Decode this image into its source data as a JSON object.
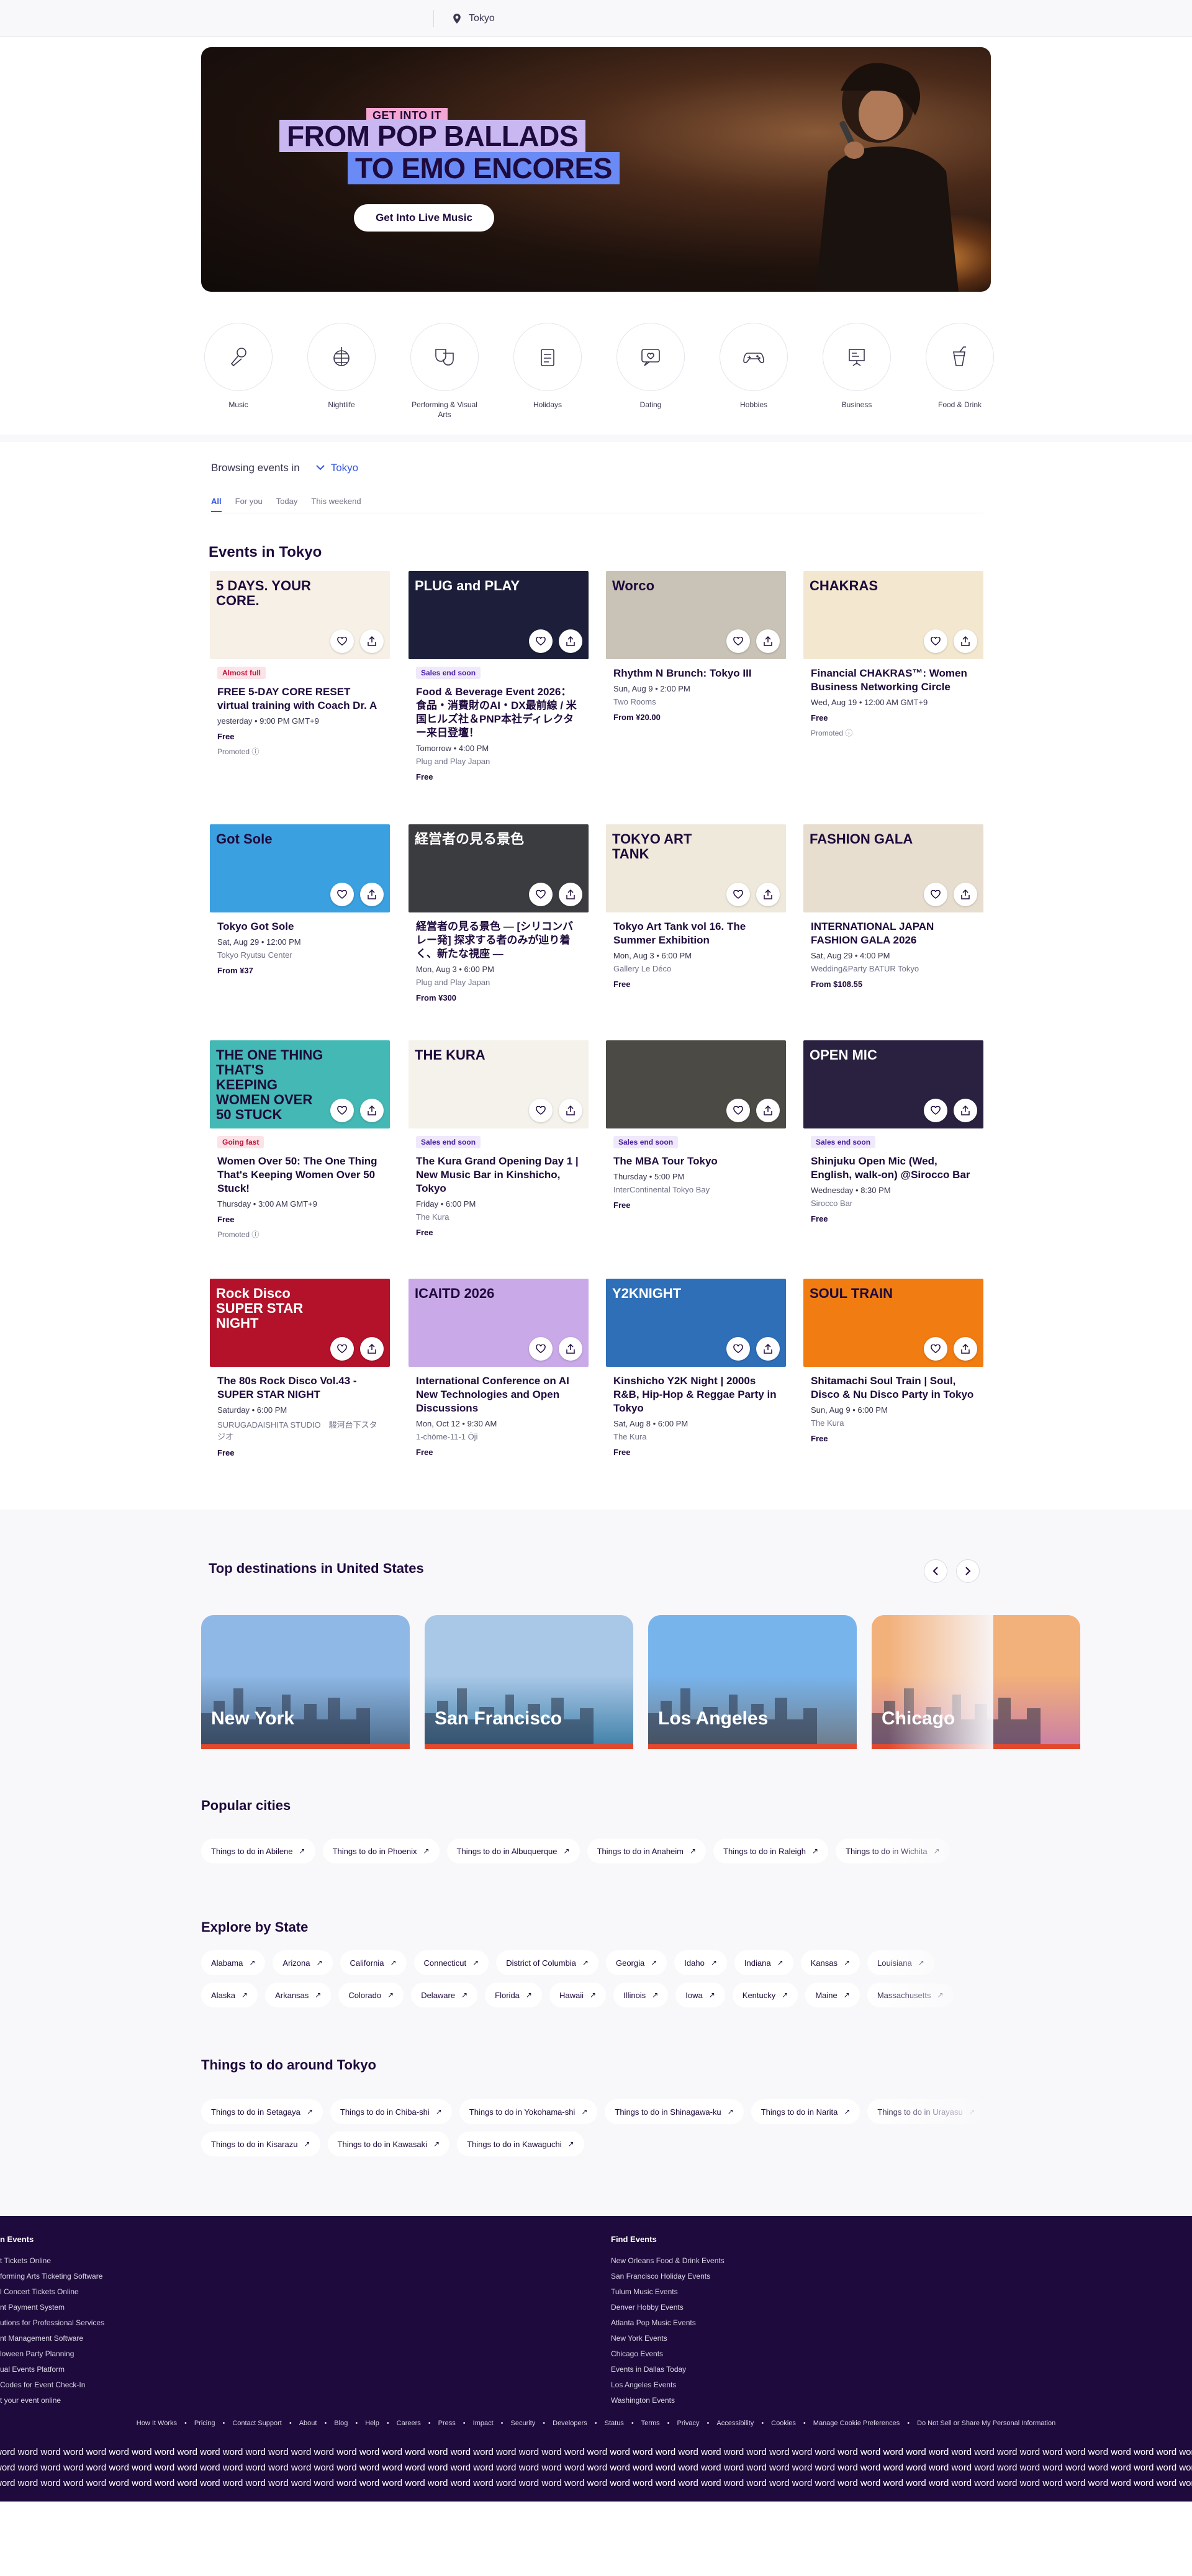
{
  "search": {
    "location": "Tokyo"
  },
  "hero": {
    "kicker": "GET INTO IT",
    "line1": "FROM POP BALLADS",
    "line2": "TO EMO ENCORES",
    "button": "Get Into Live Music"
  },
  "categories": [
    {
      "label": "Music",
      "icon": "microphone-icon"
    },
    {
      "label": "Nightlife",
      "icon": "disco-ball-icon"
    },
    {
      "label": "Performing & Visual Arts",
      "icon": "theater-masks-icon"
    },
    {
      "label": "Holidays",
      "icon": "calendar-icon"
    },
    {
      "label": "Dating",
      "icon": "chat-heart-icon"
    },
    {
      "label": "Hobbies",
      "icon": "gamepad-icon"
    },
    {
      "label": "Business",
      "icon": "presentation-icon"
    },
    {
      "label": "Food & Drink",
      "icon": "drink-icon"
    }
  ],
  "browse": {
    "label": "Browsing events in",
    "location": "Tokyo"
  },
  "tabs": [
    "All",
    "For you",
    "Today",
    "This weekend"
  ],
  "events_title": "Events in Tokyo",
  "events": [
    {
      "badge": "Almost full",
      "badge_type": "red",
      "title": "FREE 5-DAY CORE RESET virtual training with Coach Dr. A",
      "date": "yesterday • 9:00 PM GMT+9",
      "venue": "",
      "price": "Free",
      "promoted": "Promoted",
      "img_text": "5 DAYS. YOUR CORE.",
      "img_color": "#f7f0e6"
    },
    {
      "badge": "Sales end soon",
      "badge_type": "purple",
      "title": "Food & Beverage Event 2026：食品・消費財のAI・DX最前線 / 米国ヒルズ社＆PNP本社ディレクター来日登壇！",
      "date": "Tomorrow • 4:00 PM",
      "venue": "Plug and Play Japan",
      "price": "Free",
      "promoted": "",
      "img_text": "PLUG and PLAY",
      "img_color": "#1d1f3a"
    },
    {
      "badge": "",
      "badge_type": "",
      "title": "Rhythm N Brunch: Tokyo III",
      "date": "Sun, Aug 9 • 2:00 PM",
      "venue": "Two Rooms",
      "price": "From ¥20.00",
      "promoted": "",
      "img_text": "Worco",
      "img_color": "#c9c2b6"
    },
    {
      "badge": "",
      "badge_type": "",
      "title": "Financial CHAKRAS™: Women Business Networking Circle",
      "date": "Wed, Aug 19 • 12:00 AM GMT+9",
      "venue": "",
      "price": "Free",
      "promoted": "Promoted",
      "img_text": "CHAKRAS",
      "img_color": "#f3e8cf"
    },
    {
      "badge": "",
      "badge_type": "",
      "title": "Tokyo Got Sole",
      "date": "Sat, Aug 29 • 12:00 PM",
      "venue": "Tokyo Ryutsu Center",
      "price": "From ¥37",
      "promoted": "",
      "img_text": "Got Sole",
      "img_color": "#3aa0e0"
    },
    {
      "badge": "",
      "badge_type": "",
      "title": "経営者の見る景色 ― [シリコンバレー発] 探求する者のみが辿り着く、新たな視座 ―",
      "date": "Mon, Aug 3 • 6:00 PM",
      "venue": "Plug and Play Japan",
      "price": "From ¥300",
      "promoted": "",
      "img_text": "経営者の見る景色",
      "img_color": "#3a3c40"
    },
    {
      "badge": "",
      "badge_type": "",
      "title": "Tokyo Art Tank vol 16. The Summer Exhibition",
      "date": "Mon, Aug 3 • 6:00 PM",
      "venue": "Gallery Le Déco",
      "price": "Free",
      "promoted": "",
      "img_text": "TOKYO ART TANK",
      "img_color": "#efe9dc"
    },
    {
      "badge": "",
      "badge_type": "",
      "title": "INTERNATIONAL JAPAN FASHION GALA 2026",
      "date": "Sat, Aug 29 • 4:00 PM",
      "venue": "Wedding&Party BATUR Tokyo",
      "price": "From $108.55",
      "promoted": "",
      "img_text": "FASHION GALA",
      "img_color": "#e7ded0"
    },
    {
      "badge": "Going fast",
      "badge_type": "red",
      "title": "Women Over 50: The One Thing That's Keeping Women Over 50 Stuck!",
      "date": "Thursday • 3:00 AM GMT+9",
      "venue": "",
      "price": "Free",
      "promoted": "Promoted",
      "img_text": "THE ONE THING THAT'S KEEPING WOMEN OVER 50 STUCK",
      "img_color": "#43b8b4"
    },
    {
      "badge": "Sales end soon",
      "badge_type": "purple",
      "title": "The Kura Grand Opening Day 1 | New Music Bar in Kinshicho, Tokyo",
      "date": "Friday • 6:00 PM",
      "venue": "The Kura",
      "price": "Free",
      "promoted": "",
      "img_text": "THE KURA",
      "img_color": "#f4f2ea"
    },
    {
      "badge": "Sales end soon",
      "badge_type": "purple",
      "title": "The MBA Tour Tokyo",
      "date": "Thursday • 5:00 PM",
      "venue": "InterContinental Tokyo Bay",
      "price": "Free",
      "promoted": "",
      "img_text": "",
      "img_color": "#4b4a45"
    },
    {
      "badge": "Sales end soon",
      "badge_type": "purple",
      "title": "Shinjuku Open Mic (Wed, English, walk-on) @Sirocco Bar",
      "date": "Wednesday • 8:30 PM",
      "venue": "Sirocco Bar",
      "price": "Free",
      "promoted": "",
      "img_text": "OPEN MIC",
      "img_color": "#2a2140"
    },
    {
      "badge": "",
      "badge_type": "",
      "title": "The 80s Rock Disco Vol.43 - SUPER STAR NIGHT",
      "date": "Saturday • 6:00 PM",
      "venue": "SURUGADAISHITA STUDIO　駿河台下スタジオ",
      "price": "Free",
      "promoted": "",
      "img_text": "Rock Disco SUPER STAR NIGHT",
      "img_color": "#b3122a"
    },
    {
      "badge": "",
      "badge_type": "",
      "title": "International Conference on AI New Technologies and Open Discussions",
      "date": "Mon, Oct 12 • 9:30 AM",
      "venue": "1-chōme-11-1 Ōji",
      "price": "Free",
      "promoted": "",
      "img_text": "ICAITD 2026",
      "img_color": "#c9a9e8"
    },
    {
      "badge": "",
      "badge_type": "",
      "title": "Kinshicho Y2K Night | 2000s R&B, Hip-Hop & Reggae Party in Tokyo",
      "date": "Sat, Aug 8 • 6:00 PM",
      "venue": "The Kura",
      "price": "Free",
      "promoted": "",
      "img_text": "Y2KNIGHT",
      "img_color": "#2f6fb8"
    },
    {
      "badge": "",
      "badge_type": "",
      "title": "Shitamachi Soul Train | Soul, Disco & Nu Disco Party in Tokyo",
      "date": "Sun, Aug 9 • 6:00 PM",
      "venue": "The Kura",
      "price": "Free",
      "promoted": "",
      "img_text": "SOUL TRAIN",
      "img_color": "#f07c12"
    }
  ],
  "destinations": {
    "title": "Top destinations in United States",
    "items": [
      {
        "name": "New York",
        "sky": "#8fb8e6",
        "ground": "#4a6a8a"
      },
      {
        "name": "San Francisco",
        "sky": "#a9c8e8",
        "ground": "#3d7ea6"
      },
      {
        "name": "Los Angeles",
        "sky": "#78b4ec",
        "ground": "#6f7a86"
      },
      {
        "name": "Chicago",
        "sky": "#f2b07a",
        "ground": "#c97ea6"
      }
    ]
  },
  "popular_cities": {
    "title": "Popular cities",
    "items": [
      "Things to do in Abilene",
      "Things to do in Phoenix",
      "Things to do in Albuquerque",
      "Things to do in Anaheim",
      "Things to do in Raleigh",
      "Things to do in Wichita"
    ]
  },
  "states": {
    "title": "Explore by State",
    "row1": [
      "Alabama",
      "Arizona",
      "California",
      "Connecticut",
      "District of Columbia",
      "Georgia",
      "Idaho",
      "Indiana",
      "Kansas",
      "Louisiana"
    ],
    "row2": [
      "Alaska",
      "Arkansas",
      "Colorado",
      "Delaware",
      "Florida",
      "Hawaii",
      "Illinois",
      "Iowa",
      "Kentucky",
      "Maine",
      "Massachusetts"
    ]
  },
  "around": {
    "title": "Things to do around Tokyo",
    "row1": [
      "Things to do in Setagaya",
      "Things to do in Chiba-shi",
      "Things to do in Yokohama-shi",
      "Things to do in Shinagawa-ku",
      "Things to do in Narita",
      "Things to do in Urayasu"
    ],
    "row2": [
      "Things to do in Kisarazu",
      "Things to do in Kawasaki",
      "Things to do in Kawaguchi"
    ]
  },
  "footer": {
    "col1_title": "n Events",
    "col1": [
      "t Tickets Online",
      "forming Arts Ticketing Software",
      "l Concert Tickets Online",
      "nt Payment System",
      "utions for Professional Services",
      "nt Management Software",
      "loween Party Planning",
      "ual Events Platform",
      "Codes for Event Check-In",
      "t your event online"
    ],
    "col2_title": "Find Events",
    "col2": [
      "New Orleans Food & Drink Events",
      "San Francisco Holiday Events",
      "Tulum Music Events",
      "Denver Hobby Events",
      "Atlanta Pop Music Events",
      "New York Events",
      "Chicago Events",
      "Events in Dallas Today",
      "Los Angeles Events",
      "Washington Events"
    ],
    "links": [
      "How It Works",
      "Pricing",
      "Contact Support",
      "About",
      "Blog",
      "Help",
      "Careers",
      "Press",
      "Impact",
      "Security",
      "Developers",
      "Status",
      "Terms",
      "Privacy",
      "Accessibility",
      "Cookies",
      "Manage Cookie Preferences",
      "Do Not Sell or Share My Personal Information"
    ],
    "word_rows": [
      "word word word word word word word word word word word word word word word word word word word word word word word word word word word word word word word word word word word word word word word word word word word word word word word word word word word word word word word word word word word word word word word word word word word word word",
      "word word word word word word word word word word word word word word word word word word word word word word word word word word word word word word word word word word word word word word word word word word word word word word word word word word word word word word word word word word word word word word word word word word word word word",
      "word word word word word word word word word word word word word word word word word word word word word word word word word word word word word word word word word word word word word word word word word word word word word word word word word word word word word word word word word word word word word word word word word word word word word"
    ]
  },
  "colors": {
    "brand_dark": "#1e0a3c",
    "accent_blue": "#3659e3",
    "badge_red": "#c1133a",
    "badge_purple": "#4a1ea1",
    "dest_stripe": "#e3482c"
  }
}
